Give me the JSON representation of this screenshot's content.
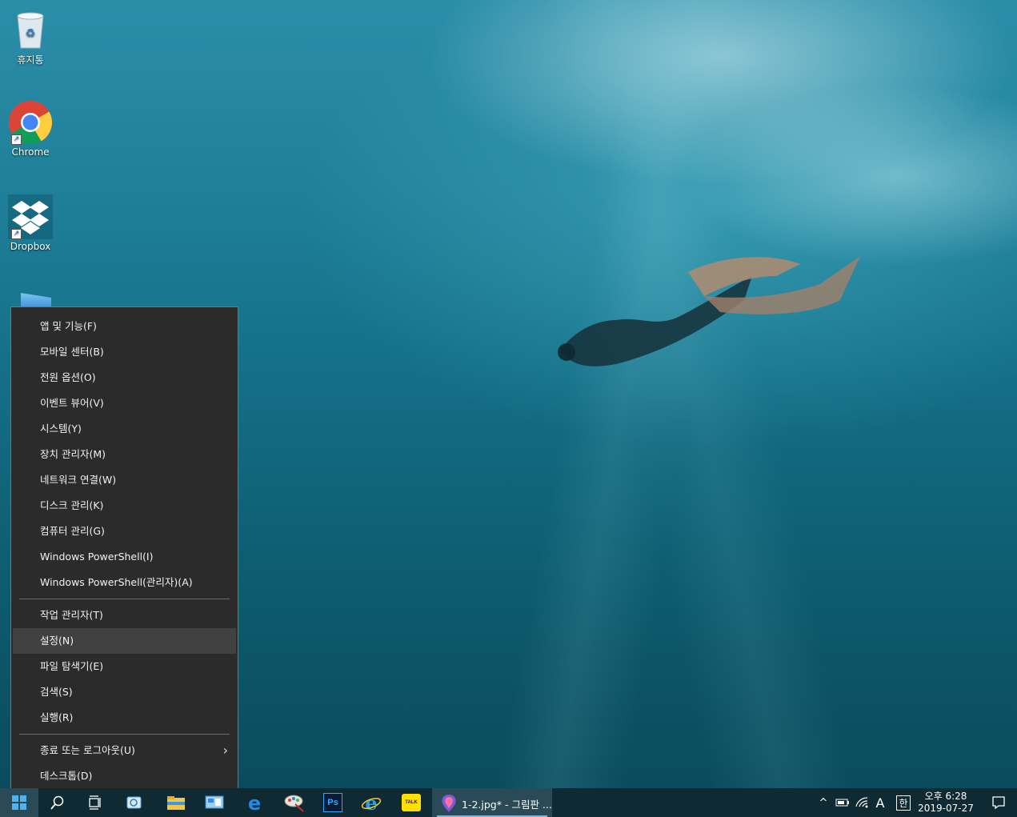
{
  "desktop": {
    "icons": [
      {
        "label": "휴지통"
      },
      {
        "label": "Chrome"
      },
      {
        "label": "Dropbox"
      }
    ]
  },
  "context_menu": {
    "group1": [
      "앱 및 기능(F)",
      "모바일 센터(B)",
      "전원 옵션(O)",
      "이벤트 뷰어(V)",
      "시스템(Y)",
      "장치 관리자(M)",
      "네트워크 연결(W)",
      "디스크 관리(K)",
      "컴퓨터 관리(G)",
      "Windows PowerShell(I)",
      "Windows PowerShell(관리자)(A)"
    ],
    "group2": [
      "작업 관리자(T)",
      "설정(N)",
      "파일 탐색기(E)",
      "검색(S)",
      "실행(R)"
    ],
    "group3": [
      "종료 또는 로그아웃(U)",
      "데스크톱(D)"
    ],
    "highlighted": "설정(N)"
  },
  "taskbar": {
    "pinned_icons": [
      "windows-start-icon",
      "search-icon",
      "task-view-icon",
      "snipping-tool-icon",
      "file-explorer-icon",
      "control-panel-icon",
      "edge-icon",
      "paint-brush-icon",
      "photoshop-icon",
      "internet-explorer-icon",
      "kakaotalk-icon",
      "paint3d-icon"
    ],
    "photoshop_text": "Ps",
    "kakao_text": "TALK",
    "active_window_title": "1-2.jpg* - 그림판 ...",
    "tray": {
      "input_mode": "A",
      "ime": "한",
      "time": "오후 6:28",
      "date": "2019-07-27"
    }
  },
  "colors": {
    "menu_bg": "#2b2b2b",
    "menu_highlight": "#414141",
    "taskbar_bg": "#0f2a33",
    "water": "#157189"
  }
}
